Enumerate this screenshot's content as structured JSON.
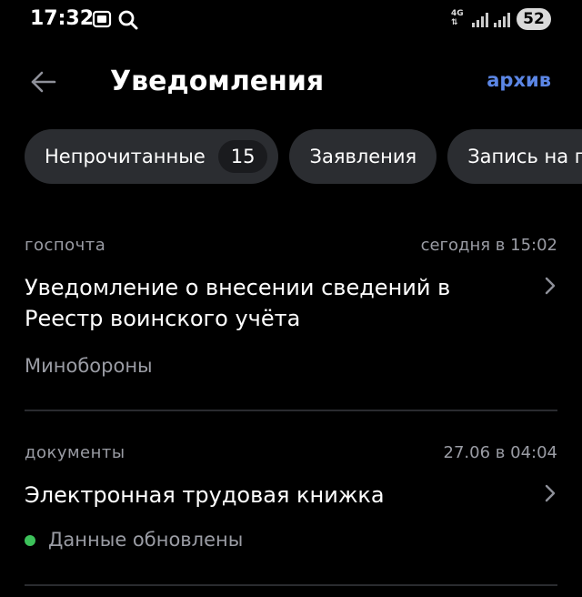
{
  "status": {
    "time": "17:32",
    "network": "4G",
    "battery": "52"
  },
  "header": {
    "title": "Уведомления",
    "archive_label": "архив"
  },
  "chips": [
    {
      "label": "Непрочитанные",
      "count": "15"
    },
    {
      "label": "Заявления"
    },
    {
      "label": "Запись на п"
    }
  ],
  "notifications": [
    {
      "category": "госпочта",
      "date": "сегодня в 15:02",
      "title_line1": "Уведомление о внесении сведений в",
      "title_line2": "Реестр воинского учёта",
      "sender": "Минобороны"
    },
    {
      "category": "документы",
      "date": "27.06 в 04:04",
      "title_line1": "Электронная трудовая книжка",
      "status": "Данные обновлены",
      "status_color": "#3cc15a"
    }
  ],
  "colors": {
    "accent": "#5b86e5",
    "chip_bg": "#2b2d31",
    "muted_text": "#9a9ca4"
  }
}
